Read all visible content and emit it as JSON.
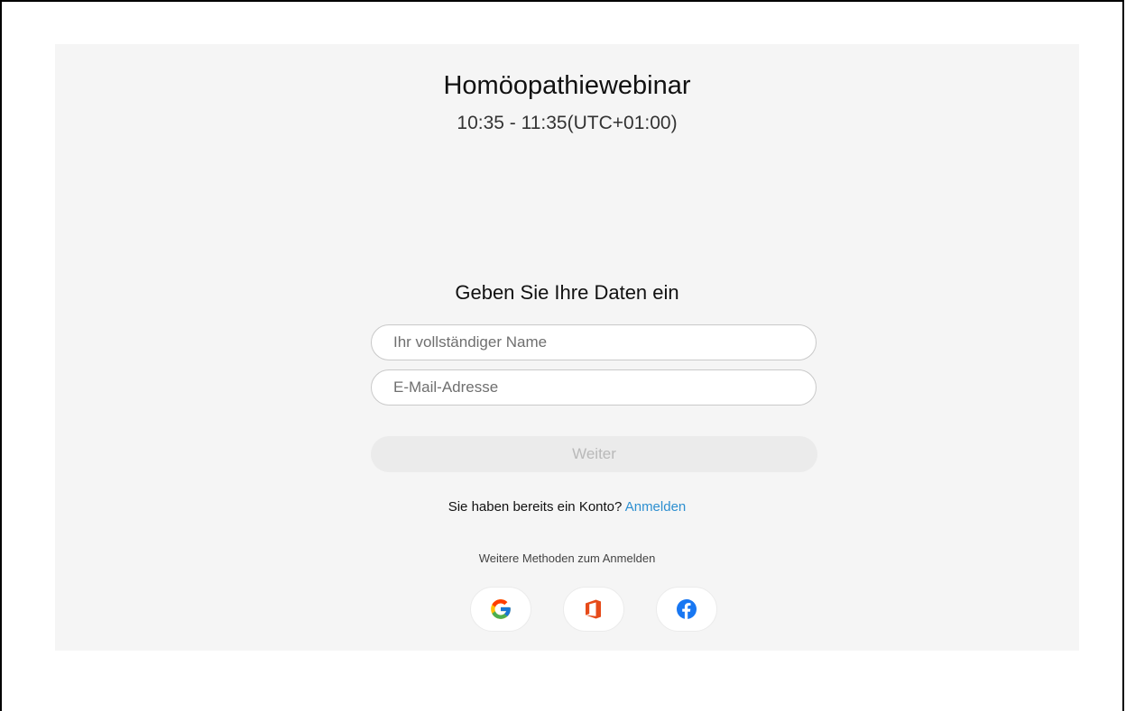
{
  "event": {
    "title": "Homöopathiewebinar",
    "time": "10:35 - 11:35(UTC+01:00)"
  },
  "form": {
    "heading": "Geben Sie Ihre Daten ein",
    "name_placeholder": "Ihr vollständiger Name",
    "name_value": "",
    "email_placeholder": "E-Mail-Adresse",
    "email_value": "",
    "continue_label": "Weiter",
    "continue_enabled": false
  },
  "account": {
    "prompt": "Sie haben bereits ein Konto?",
    "signin_link": "Anmelden"
  },
  "other_methods": {
    "label": "Weitere Methoden zum Anmelden",
    "providers": [
      {
        "name": "Google",
        "icon": "google-icon"
      },
      {
        "name": "Office",
        "icon": "office-icon"
      },
      {
        "name": "Facebook",
        "icon": "facebook-icon"
      }
    ]
  },
  "colors": {
    "panel_background": "#f5f5f5",
    "link": "#2d8fd0",
    "button_disabled_bg": "#ebebeb",
    "button_disabled_text": "#b9b9b9",
    "office_orange": "#e64a19",
    "facebook_blue": "#1877f2"
  }
}
